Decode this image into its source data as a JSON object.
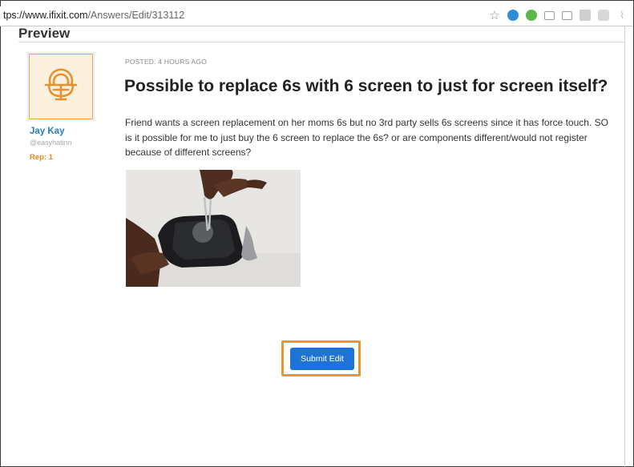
{
  "browser": {
    "url_host": "tps://www.ifixit.com",
    "url_path": "/Answers/Edit/313112",
    "icons": [
      "star-icon",
      "onetab-icon",
      "evernote-icon",
      "cast-icon",
      "cast-icon",
      "extension-icon",
      "pocket-icon",
      "wifi-icon"
    ]
  },
  "preview_label": "Preview",
  "author": {
    "name": "Jay Kay",
    "handle": "@easyhatinn",
    "rep": "Rep: 1"
  },
  "post": {
    "posted": "POSTED: 4 HOURS AGO",
    "title": "Possible to replace 6s with 6 screen to just for screen itself?",
    "body": "Friend wants a screen replacement on her moms 6s but no 3rd party sells 6s screens since it has force touch. SO is it possible for me to just buy the 6 screen to replace the 6s? or are components different/would not register because of different screens?"
  },
  "submit_label": "Submit Edit",
  "colors": {
    "accent": "#f2922a",
    "button": "#1f73d4",
    "author_link": "#2a7ab8"
  }
}
